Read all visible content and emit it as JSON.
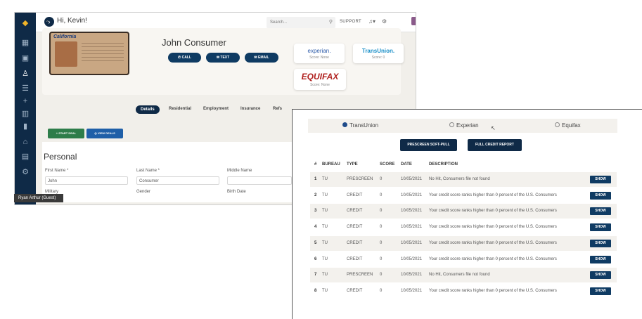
{
  "sidebar": {
    "user_label": "Ryan Arthur (Guest)"
  },
  "topbar": {
    "greeting": "Hi, Kevin!",
    "search_placeholder": "Search...",
    "support": "SUPPORT"
  },
  "profile": {
    "license_state": "California",
    "name": "John Consumer",
    "actions": [
      "CALL",
      "TEXT",
      "EMAIL"
    ],
    "bureaus": [
      {
        "name": "experian.",
        "score": "Score: None",
        "color": "#2b5aa8"
      },
      {
        "name": "TransUnion.",
        "score": "Score: 0",
        "color": "#1a8fc8"
      },
      {
        "name": "EQUIFAX",
        "score": "Score: None",
        "color": "#b0201e"
      }
    ]
  },
  "tabs": [
    "Details",
    "Residential",
    "Employment",
    "Insurance",
    "Refs"
  ],
  "deal_buttons": [
    "START DEAL",
    "VIEW DEALS"
  ],
  "personal": {
    "title": "Personal",
    "first_name_label": "First Name *",
    "first_name": "John",
    "last_name_label": "Last Name *",
    "last_name": "Consumer",
    "middle_name_label": "Middle Name",
    "military_label": "Military",
    "gender_label": "Gender",
    "birth_date_label": "Birth Date"
  },
  "credit": {
    "radios": [
      {
        "label": "TransUnion",
        "selected": true
      },
      {
        "label": "Experian",
        "selected": false
      },
      {
        "label": "Equifax",
        "selected": false
      }
    ],
    "buttons": [
      "PRESCREEN SOFT-PULL",
      "FULL CREDIT REPORT"
    ],
    "headers": [
      "#",
      "BUREAU",
      "TYPE",
      "SCORE",
      "DATE",
      "DESCRIPTION"
    ],
    "show_label": "SHOW",
    "rows": [
      [
        "1",
        "TU",
        "PRESCREEN",
        "0",
        "10/05/2021",
        "No Hit, Consumers file not found"
      ],
      [
        "2",
        "TU",
        "CREDIT",
        "0",
        "10/05/2021",
        "Your credit score ranks higher than 0 percent of the U.S. Consumers"
      ],
      [
        "3",
        "TU",
        "CREDIT",
        "0",
        "10/05/2021",
        "Your credit score ranks higher than 0 percent of the U.S. Consumers"
      ],
      [
        "4",
        "TU",
        "CREDIT",
        "0",
        "10/05/2021",
        "Your credit score ranks higher than 0 percent of the U.S. Consumers"
      ],
      [
        "5",
        "TU",
        "CREDIT",
        "0",
        "10/05/2021",
        "Your credit score ranks higher than 0 percent of the U.S. Consumers"
      ],
      [
        "6",
        "TU",
        "CREDIT",
        "0",
        "10/05/2021",
        "Your credit score ranks higher than 0 percent of the U.S. Consumers"
      ],
      [
        "7",
        "TU",
        "PRESCREEN",
        "0",
        "10/05/2021",
        "No Hit, Consumers file not found"
      ],
      [
        "8",
        "TU",
        "CREDIT",
        "0",
        "10/05/2021",
        "Your credit score ranks higher than 0 percent of the U.S. Consumers"
      ]
    ]
  }
}
